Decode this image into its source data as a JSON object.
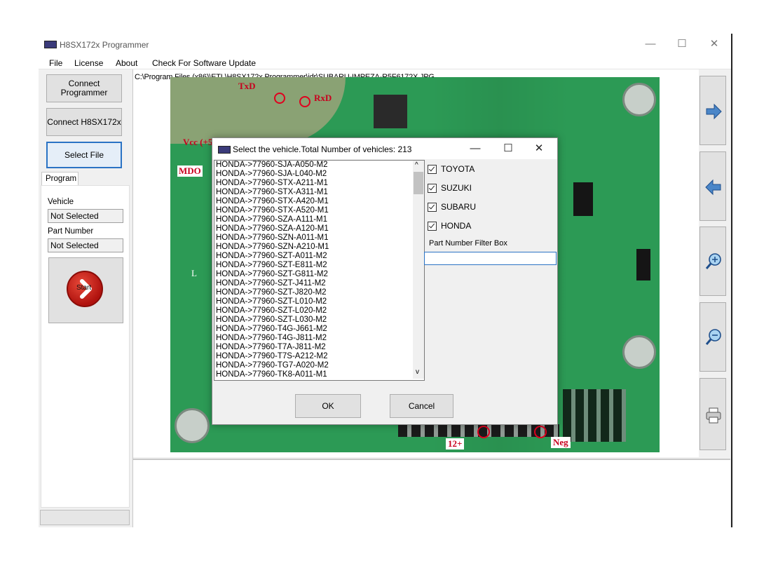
{
  "window": {
    "title": "H8SX172x Programmer",
    "minimize_glyph": "—",
    "maximize_glyph": "☐",
    "close_glyph": "✕"
  },
  "menu": {
    "file": "File",
    "license": "License",
    "about": "About",
    "update": "Check For Software Update"
  },
  "sidebar": {
    "connect_programmer": "Connect Programmer",
    "connect_chip": "Connect H8SX172x",
    "select_file": "Select File",
    "tab_program": "Program",
    "vehicle_label": "Vehicle",
    "vehicle_value": "Not Selected",
    "part_label": "Part Number",
    "part_value": "Not Selected",
    "start_label": "Start"
  },
  "image_path": "C:\\Program Files (x86)\\ETL\\H8SX172x Programmer\\idr\\SUBARU-IMPEZA-R5F6172X.JPG",
  "pcb_labels": {
    "txd": "TxD",
    "rxd": "RxD",
    "vcc": "Vcc (+5",
    "mdo": "MDO",
    "l": "L",
    "pos12": "12+",
    "neg": "Neg"
  },
  "right_toolbar": [
    "arrow-right-icon",
    "arrow-left-icon",
    "zoom-in-icon",
    "zoom-out-icon",
    "printer-icon"
  ],
  "dialog": {
    "title": "Select the vehicle.Total Number of vehicles: 213",
    "minimize_glyph": "—",
    "maximize_glyph": "☐",
    "close_glyph": "✕",
    "vehicles": [
      "HONDA->77960-SJA-A050-M2",
      "HONDA->77960-SJA-L040-M2",
      "HONDA->77960-STX-A211-M1",
      "HONDA->77960-STX-A311-M1",
      "HONDA->77960-STX-A420-M1",
      "HONDA->77960-STX-A520-M1",
      "HONDA->77960-SZA-A111-M1",
      "HONDA->77960-SZA-A120-M1",
      "HONDA->77960-SZN-A011-M1",
      "HONDA->77960-SZN-A210-M1",
      "HONDA->77960-SZT-A011-M2",
      "HONDA->77960-SZT-E811-M2",
      "HONDA->77960-SZT-G811-M2",
      "HONDA->77960-SZT-J411-M2",
      "HONDA->77960-SZT-J820-M2",
      "HONDA->77960-SZT-L010-M2",
      "HONDA->77960-SZT-L020-M2",
      "HONDA->77960-SZT-L030-M2",
      "HONDA->77960-T4G-J661-M2",
      "HONDA->77960-T4G-J811-M2",
      "HONDA->77960-T7A-J811-M2",
      "HONDA->77960-T7S-A212-M2",
      "HONDA->77960-TG7-A020-M2",
      "HONDA->77960-TK8-A011-M1"
    ],
    "filters": [
      "TOYOTA",
      "SUZUKI",
      "SUBARU",
      "HONDA"
    ],
    "filter_box_label": "Part Number Filter Box",
    "filter_box_value": "",
    "ok": "OK",
    "cancel": "Cancel",
    "scroll_up_glyph": "^",
    "scroll_down_glyph": "v"
  }
}
